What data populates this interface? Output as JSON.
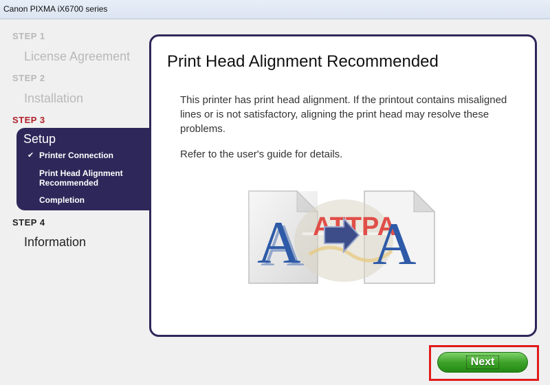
{
  "window": {
    "title": "Canon PIXMA iX6700 series"
  },
  "steps": [
    {
      "label": "STEP 1",
      "title": "License Agreement"
    },
    {
      "label": "STEP 2",
      "title": "Installation"
    },
    {
      "label": "STEP 3",
      "title": "Setup",
      "substeps": [
        "Printer Connection",
        "Print Head Alignment Recommended",
        "Completion"
      ],
      "check_mark": "✔"
    },
    {
      "label": "STEP 4",
      "title": "Information"
    }
  ],
  "content": {
    "title": "Print Head Alignment Recommended",
    "body": "This printer has print head alignment. If the printout contains misaligned lines or is not satisfactory, aligning the print head may resolve these problems.",
    "refer": "Refer to the user's guide for details."
  },
  "illustration": {
    "left_letter": "A",
    "right_letter": "A",
    "watermark": "ATTPA"
  },
  "footer": {
    "next_label": "Next"
  },
  "colors": {
    "panel": "#2e2759",
    "active_step": "#b0202a",
    "next_green": "#3ea22a",
    "highlight": "#e01a1a"
  }
}
